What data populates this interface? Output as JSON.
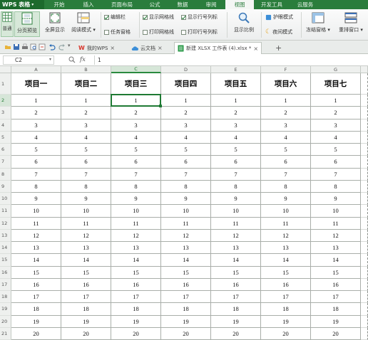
{
  "app": {
    "title": "WPS 表格"
  },
  "menu": [
    "开始",
    "插入",
    "页面布局",
    "公式",
    "数据",
    "审阅",
    "视图",
    "开发工具",
    "云服务"
  ],
  "menu_active": 6,
  "ribbon": {
    "normal": "普通",
    "page_break_preview": "分页预览",
    "full_screen": "全屏显示",
    "reading_mode": "阅读模式",
    "edit_bar": "编辑栏",
    "task_pane": "任务窗格",
    "show_gridlines": "显示网格线",
    "show_row_col_headers": "显示行号列标",
    "print_gridlines": "打印网格线",
    "print_row_col_headers": "打印行号列标",
    "zoom": "显示比例",
    "eye_protection": "护眼模式",
    "night_mode": "夜间模式",
    "freeze_panes": "冻结窗格",
    "rearrange_windows": "重排窗口"
  },
  "tabs": {
    "my_wps": "我的WPS",
    "cloud_docs": "云文档",
    "current_file": "新建 XLSX 工作表 (4).xlsx *",
    "new_tab": "+"
  },
  "formula_bar": {
    "name_box": "C2",
    "fx": "fx",
    "content": "1"
  },
  "sheet": {
    "columns": [
      "A",
      "B",
      "C",
      "D",
      "E",
      "F",
      "G"
    ],
    "selected_column": "C",
    "selected_row": 2,
    "row_numbers": [
      "1",
      "2",
      "3",
      "4",
      "5",
      "6",
      "7",
      "8",
      "9",
      "10",
      "11",
      "12",
      "13",
      "14",
      "15",
      "16",
      "17",
      "18",
      "19",
      "20",
      "21"
    ],
    "headers": [
      "项目一",
      "项目二",
      "项目三",
      "项目四",
      "项目五",
      "项目六",
      "项目七"
    ],
    "values": [
      "1",
      "2",
      "3",
      "4",
      "5",
      "6",
      "7",
      "8",
      "9",
      "10",
      "11",
      "12",
      "13",
      "14",
      "15",
      "16",
      "17",
      "18",
      "19",
      "20"
    ]
  },
  "colors": {
    "accent": "#2a7d3c",
    "selection": "#1f7a34",
    "header_bg": "#eef0ee"
  }
}
